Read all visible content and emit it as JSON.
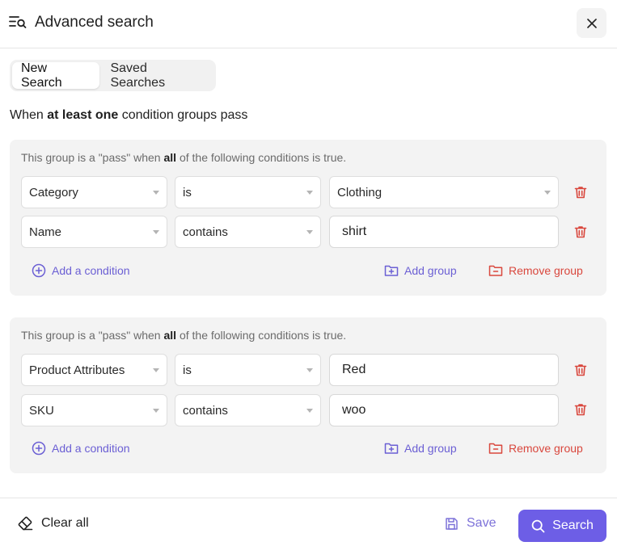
{
  "header": {
    "title": "Advanced search"
  },
  "tabs": [
    {
      "label": "New Search",
      "active": true
    },
    {
      "label": "Saved Searches",
      "active": false
    }
  ],
  "rule": {
    "prefix": "When",
    "emphasis": "at least one",
    "suffix": "condition groups pass"
  },
  "groups": [
    {
      "desc_prefix": "This group is a \"pass\" when",
      "desc_emphasis": "all",
      "desc_suffix": "of the following conditions is true.",
      "conditions": [
        {
          "field": "Category",
          "operator": "is",
          "value": "Clothing",
          "value_is_select": true
        },
        {
          "field": "Name",
          "operator": "contains",
          "value": "shirt",
          "value_is_select": false
        }
      ],
      "add_condition": "Add a condition",
      "add_group": "Add group",
      "remove_group": "Remove group"
    },
    {
      "desc_prefix": "This group is a \"pass\" when",
      "desc_emphasis": "all",
      "desc_suffix": "of the following conditions is true.",
      "conditions": [
        {
          "field": "Product Attributes",
          "operator": "is",
          "value": "Red",
          "value_is_select": false
        },
        {
          "field": "SKU",
          "operator": "contains",
          "value": "woo",
          "value_is_select": false
        }
      ],
      "add_condition": "Add a condition",
      "add_group": "Add group",
      "remove_group": "Remove group"
    }
  ],
  "footer": {
    "clear_label": "Clear all",
    "save_label": "Save",
    "search_label": "Search"
  },
  "colors": {
    "accent": "#6d5ee6",
    "link_purple": "#6b5fd4",
    "danger": "#d9473d"
  }
}
